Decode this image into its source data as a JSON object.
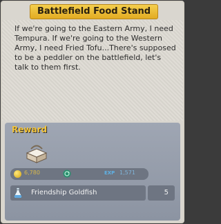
{
  "quest": {
    "title": "Battlefield Food Stand",
    "description": "If we're going to the Eastern Army, I need Tempura. If we're going to the Western Army, I need Fried Tofu...There's supposed to be a peddler on the battlefield, let's talk to them first."
  },
  "reward": {
    "label": "Reward",
    "gold": "6,780",
    "exp_label": "EXP",
    "exp": "1,571",
    "items": [
      {
        "name": "Friendship Goldfish",
        "quantity": "5",
        "icon": "potion-icon"
      }
    ]
  },
  "colors": {
    "title_bar": "#e9bc34",
    "reward_label": "#f3c43a",
    "reward_panel": "#979eab"
  }
}
